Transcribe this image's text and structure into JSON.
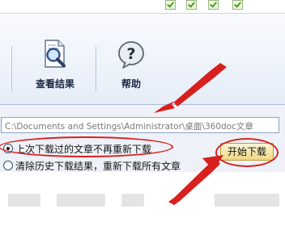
{
  "toolbar": {
    "view_results_label": "查看结果",
    "help_label": "帮助"
  },
  "path": {
    "value": "C:\\Documents and Settings\\Administrator\\桌面\\360doc文章"
  },
  "options": {
    "option1_label": "上次下载过的文章不再重新下载",
    "option2_label": "清除历史下载结果，重新下载所有文章",
    "selected": "option1"
  },
  "start_button": {
    "label": "开始下载"
  },
  "icons": {
    "view_results": "magnifier-document-icon",
    "help": "question-bubble-icon",
    "top_checkboxes": "checked-checkbox-icon"
  },
  "colors": {
    "annotation_red": "#d8201f",
    "window_bg": "#eef2f8",
    "button_gold": "#f0d681"
  }
}
